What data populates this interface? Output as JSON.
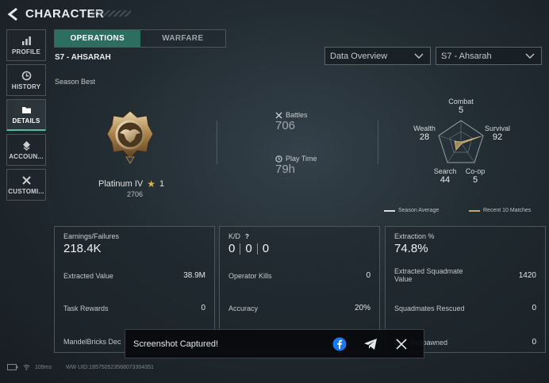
{
  "header": {
    "title": "CHARACTER"
  },
  "sidebar": {
    "items": [
      {
        "label": "PROFILE",
        "icon": "bar-chart-icon"
      },
      {
        "label": "HISTORY",
        "icon": "clock-icon"
      },
      {
        "label": "DETAILS",
        "icon": "folder-icon",
        "active": true
      },
      {
        "label": "ACCOUN...",
        "icon": "diamond-stack-icon"
      },
      {
        "label": "CUSTOMI...",
        "icon": "crossed-tools-icon"
      }
    ]
  },
  "tabs": [
    {
      "label": "OPERATIONS",
      "active": true
    },
    {
      "label": "WARFARE",
      "active": false
    }
  ],
  "season_name": "S7 - AHSARAH",
  "dropdowns": {
    "view": {
      "selected": "Data Overview"
    },
    "season": {
      "selected": "S7 - Ahsarah"
    }
  },
  "season_best": {
    "label": "Season Best",
    "rank": "Platinum IV",
    "stars": "1",
    "points": "2706"
  },
  "battle_stats": {
    "battles": {
      "label": "Battles",
      "value": "706"
    },
    "play_time": {
      "label": "Play Time",
      "value": "79h"
    }
  },
  "radar": {
    "axes": [
      {
        "label": "Combat",
        "value": "5"
      },
      {
        "label": "Survival",
        "value": "92"
      },
      {
        "label": "Co-op",
        "value": "5"
      },
      {
        "label": "Search",
        "value": "44"
      },
      {
        "label": "Wealth",
        "value": "28"
      }
    ],
    "legend": {
      "season_average": "Season Average",
      "recent_10": "Recent 10 Matches"
    }
  },
  "cards": {
    "earnings": {
      "header": "Earnings/Failures",
      "value": "218.4K",
      "rows": [
        {
          "label": "Extracted Value",
          "value": "38.9M"
        },
        {
          "label": "Task Rewards",
          "value": "0"
        },
        {
          "label": "MandelBricks Dec",
          "value": ""
        }
      ]
    },
    "kd": {
      "header": "K/D",
      "help": "?",
      "values": [
        "0",
        "0",
        "0"
      ],
      "rows": [
        {
          "label": "Operator Kills",
          "value": "0"
        },
        {
          "label": "Accuracy",
          "value": "20%"
        }
      ]
    },
    "extraction": {
      "header": "Extraction %",
      "value": "74.8%",
      "rows": [
        {
          "label": "Extracted Squadmate Value",
          "value": "1420"
        },
        {
          "label": "Squadmates Rescued",
          "value": "0"
        },
        {
          "label": "ates Respawned",
          "value": "0"
        }
      ]
    }
  },
  "toast": {
    "text": "Screenshot Captured!"
  },
  "footer": {
    "ping": "109ms",
    "uid": "WW UID:18575052356807330435​1"
  },
  "colors": {
    "accent": "#2c6e60",
    "active_underline": "#4dc39a",
    "recent_matches": "#c9a86a",
    "season_average": "#d8dde0",
    "facebook": "#1877f2"
  }
}
